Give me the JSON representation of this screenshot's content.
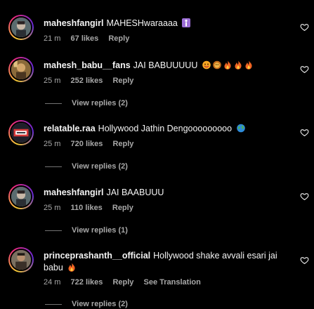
{
  "comments": [
    {
      "username": "maheshfangirl",
      "text": "MAHESHwaraaaa",
      "emojis": [
        "person-emoji"
      ],
      "time": "21 m",
      "likes": "67 likes",
      "reply": "Reply",
      "view_replies": null
    },
    {
      "username": "mahesh_babu__fans",
      "text": "JAI BABUUUUU",
      "emojis": [
        "face-emoji",
        "lion-emoji",
        "fire-emoji",
        "fire-emoji",
        "fire-emoji"
      ],
      "time": "25 m",
      "likes": "252 likes",
      "reply": "Reply",
      "view_replies": "View replies (2)"
    },
    {
      "username": "relatable.raa",
      "text": "Hollywood Jathin Dengooooooooo",
      "emojis": [
        "globe-emoji"
      ],
      "time": "25 m",
      "likes": "720 likes",
      "reply": "Reply",
      "view_replies": "View replies (2)"
    },
    {
      "username": "maheshfangirl",
      "text": "JAI BAABUUU",
      "emojis": [],
      "time": "25 m",
      "likes": "110 likes",
      "reply": "Reply",
      "view_replies": "View replies (1)"
    },
    {
      "username": "princeprashanth__official",
      "text": "Hollywood shake avvali esari jai babu",
      "emojis": [
        "fire-emoji"
      ],
      "time": "24 m",
      "likes": "722 likes",
      "reply": "Reply",
      "translate": "See Translation",
      "view_replies": "View replies (2)"
    }
  ],
  "colors": {
    "background": "#000000",
    "text": "#f5f5f5",
    "secondary": "#a8a8a8",
    "divider": "#737373"
  }
}
